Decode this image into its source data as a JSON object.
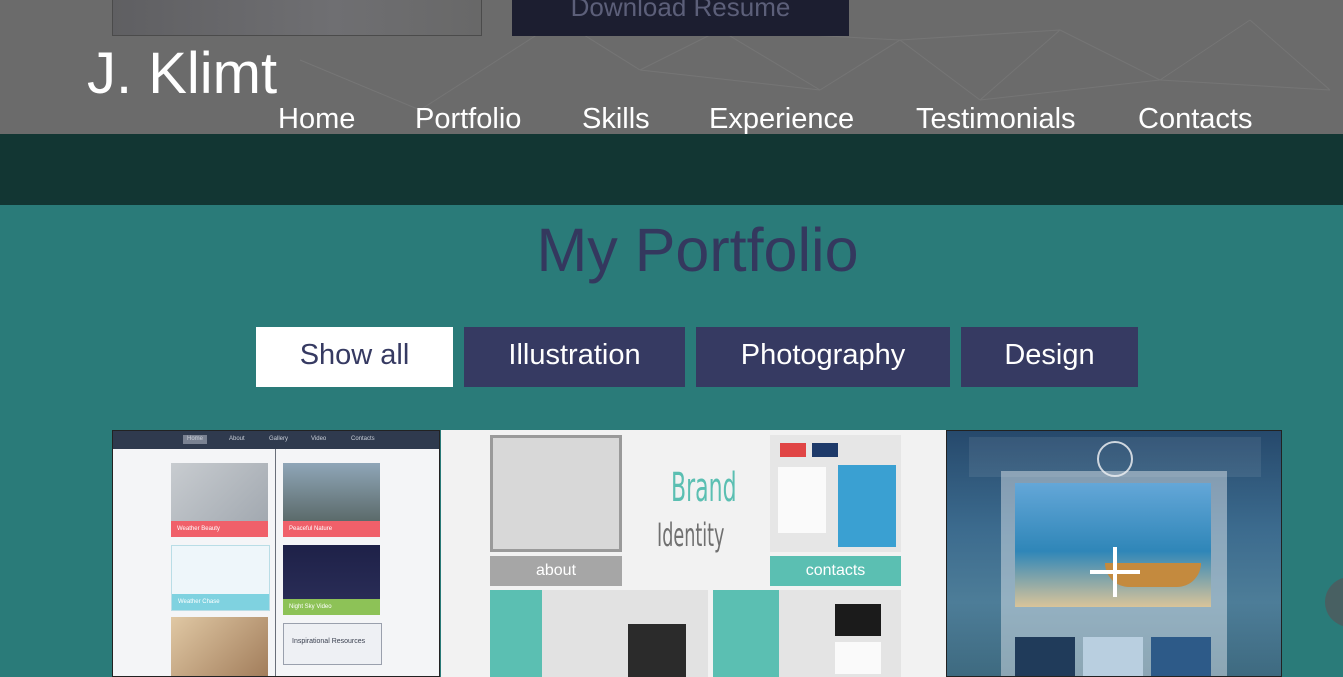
{
  "header": {
    "download_label": "Download Resume",
    "logo": "J. Klimt",
    "nav": [
      {
        "label": "Home",
        "active": false
      },
      {
        "label": "Portfolio",
        "active": true
      },
      {
        "label": "Skills",
        "active": false
      },
      {
        "label": "Experience",
        "active": false
      },
      {
        "label": "Testimonials",
        "active": false
      },
      {
        "label": "Contacts",
        "active": false
      }
    ]
  },
  "portfolio": {
    "title": "My Portfolio",
    "filters": [
      {
        "label": "Show all",
        "active": true
      },
      {
        "label": "Illustration",
        "active": false
      },
      {
        "label": "Photography",
        "active": false
      },
      {
        "label": "Design",
        "active": false
      }
    ],
    "items": [
      {
        "nav": [
          "Home",
          "About",
          "Gallery",
          "Video",
          "Contacts"
        ],
        "cards": [
          "Weather Beauty",
          "Peaceful Nature",
          "Weather Chase",
          "Night Sky Video",
          "Inspirational Resources"
        ]
      },
      {
        "brand_title": "Brand",
        "brand_sub": "Identity",
        "labels": [
          "about",
          "contacts"
        ]
      },
      {
        "hover_icon": "plus-icon"
      }
    ]
  },
  "colors": {
    "header_bg": "#6b6b6b",
    "band_bg": "#123633",
    "page_bg": "#2a7b79",
    "accent_navy": "#363a62",
    "title_color": "#34385e",
    "teal_accent": "#5bbfb2"
  }
}
